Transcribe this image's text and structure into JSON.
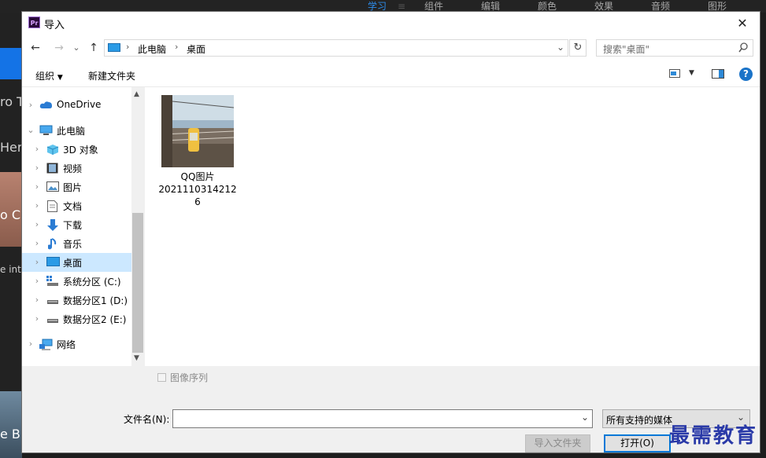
{
  "background": {
    "menu_tabs": [
      "学习",
      "组件",
      "编辑",
      "颜色",
      "效果",
      "音频",
      "图形"
    ],
    "left_texts": [
      "ro T",
      "Here",
      "o C",
      "e inte",
      "e B"
    ]
  },
  "dialog": {
    "title": "导入",
    "app_icon_text": "Pr",
    "close": "✕"
  },
  "nav": {
    "back": "←",
    "forward": "→",
    "recent": "⌄",
    "up": "↑",
    "path": [
      "此电脑",
      "桌面"
    ],
    "refresh": "↻",
    "search_placeholder": "搜索\"桌面\""
  },
  "toolbar": {
    "organize": "组织",
    "new_folder": "新建文件夹"
  },
  "tree": [
    {
      "label": "OneDrive",
      "icon": "cloud-icon",
      "level": 0
    },
    {
      "label": "此电脑",
      "icon": "computer-icon",
      "level": 0,
      "expanded": true
    },
    {
      "label": "3D 对象",
      "icon": "cube-icon",
      "level": 1
    },
    {
      "label": "视频",
      "icon": "video-icon",
      "level": 1
    },
    {
      "label": "图片",
      "icon": "picture-icon",
      "level": 1
    },
    {
      "label": "文档",
      "icon": "document-icon",
      "level": 1
    },
    {
      "label": "下载",
      "icon": "download-icon",
      "level": 1
    },
    {
      "label": "音乐",
      "icon": "music-icon",
      "level": 1
    },
    {
      "label": "桌面",
      "icon": "desktop-icon",
      "level": 1,
      "selected": true
    },
    {
      "label": "系统分区 (C:)",
      "icon": "system-drive-icon",
      "level": 1
    },
    {
      "label": "数据分区1 (D:)",
      "icon": "drive-icon",
      "level": 1
    },
    {
      "label": "数据分区2 (E:)",
      "icon": "drive-icon",
      "level": 1
    },
    {
      "label": "网络",
      "icon": "network-icon",
      "level": 0
    }
  ],
  "files": [
    {
      "name_line1": "QQ图片",
      "name_line2": "2021110314212",
      "name_line3": "6"
    }
  ],
  "bottom": {
    "image_sequence": "图像序列",
    "filename_label": "文件名(N):",
    "filename_value": "",
    "filetype": "所有支持的媒体",
    "import_folder": "导入文件夹",
    "open": "打开(O)"
  },
  "watermark": "最需教育",
  "colors": {
    "selection": "#cce8ff",
    "accent": "#0078d7",
    "help": "#1a73c8"
  }
}
